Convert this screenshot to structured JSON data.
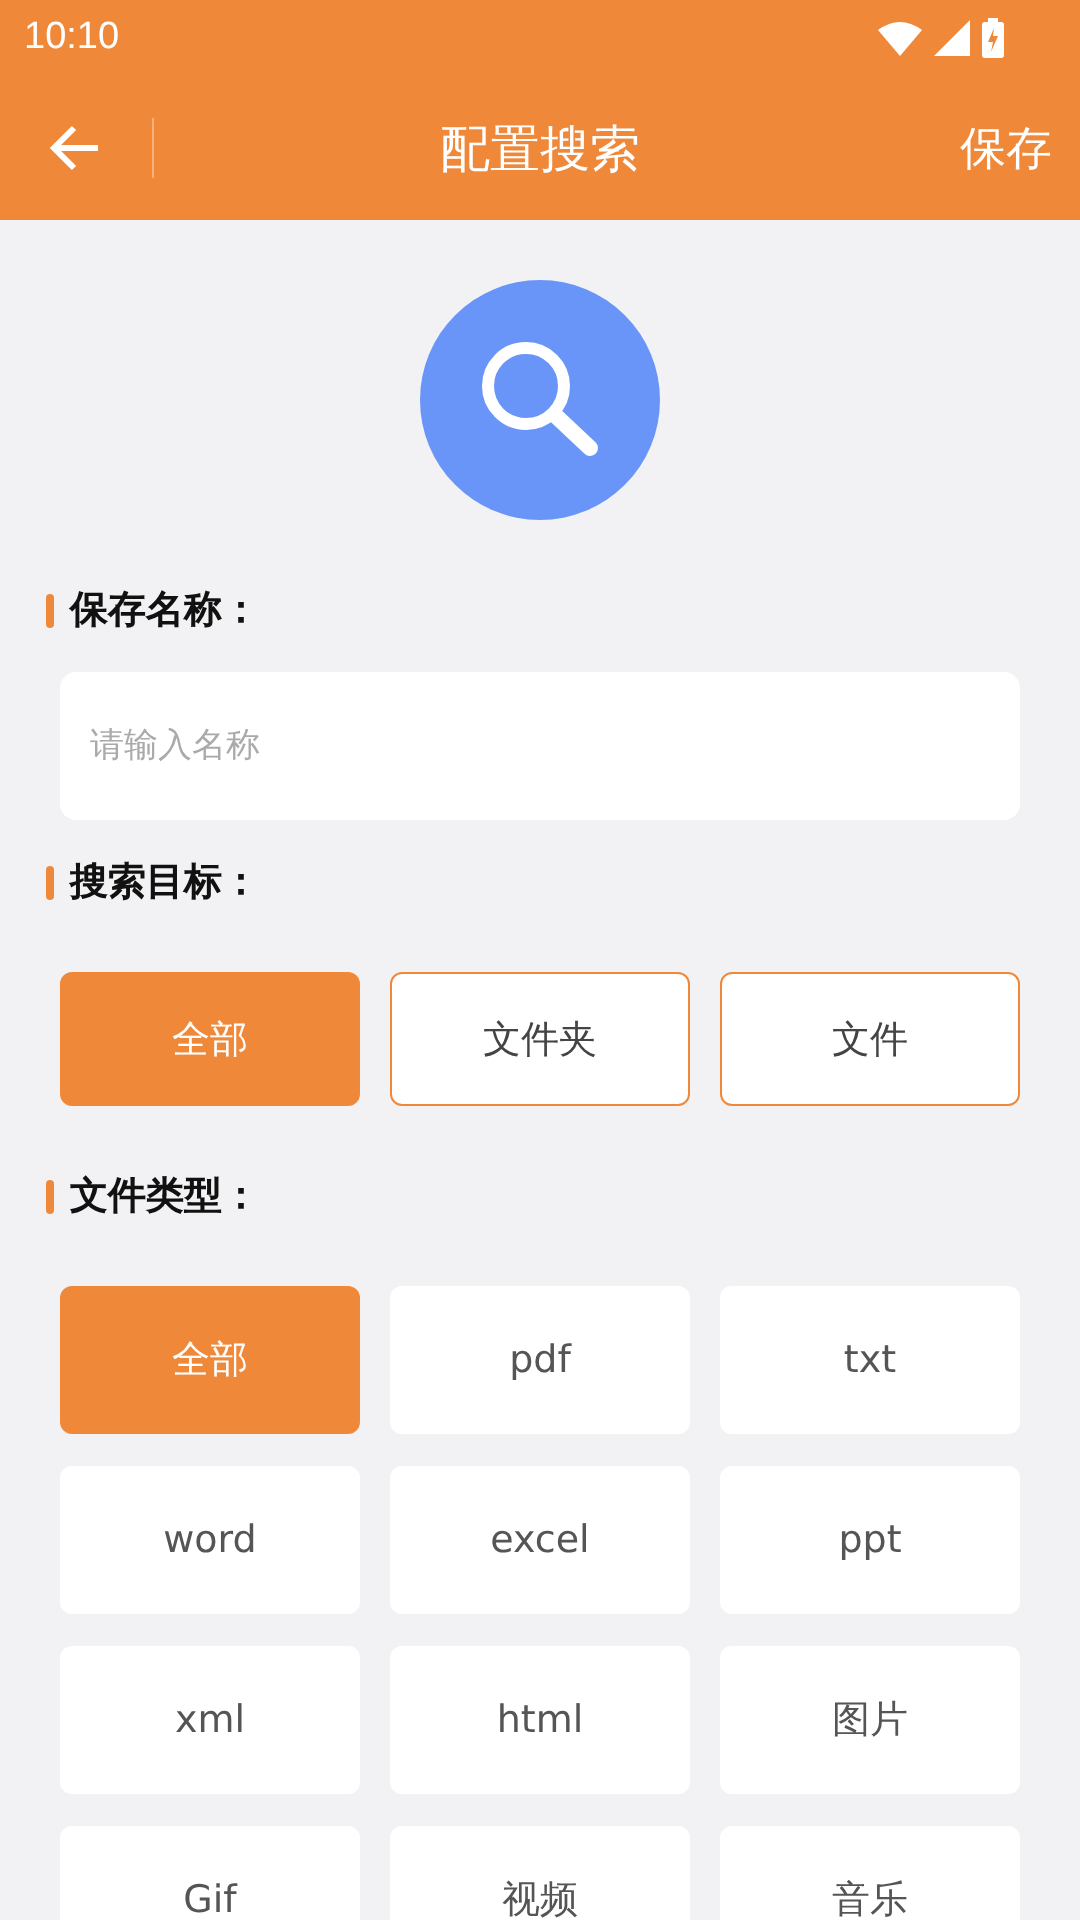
{
  "status_bar": {
    "time": "10:10"
  },
  "toolbar": {
    "title": "配置搜索",
    "action": "保存"
  },
  "name_section": {
    "label": "保存名称：",
    "placeholder": "请输入名称"
  },
  "target_section": {
    "label": "搜索目标：",
    "options": [
      {
        "label": "全部",
        "selected": true
      },
      {
        "label": "文件夹",
        "selected": false
      },
      {
        "label": "文件",
        "selected": false
      }
    ]
  },
  "type_section": {
    "label": "文件类型：",
    "options": [
      {
        "label": "全部",
        "selected": true
      },
      {
        "label": "pdf",
        "selected": false
      },
      {
        "label": "txt",
        "selected": false
      },
      {
        "label": "word",
        "selected": false
      },
      {
        "label": "excel",
        "selected": false
      },
      {
        "label": "ppt",
        "selected": false
      },
      {
        "label": "xml",
        "selected": false
      },
      {
        "label": "html",
        "selected": false
      },
      {
        "label": "图片",
        "selected": false
      },
      {
        "label": "Gif",
        "selected": false
      },
      {
        "label": "视频",
        "selected": false
      },
      {
        "label": "音乐",
        "selected": false
      }
    ]
  }
}
